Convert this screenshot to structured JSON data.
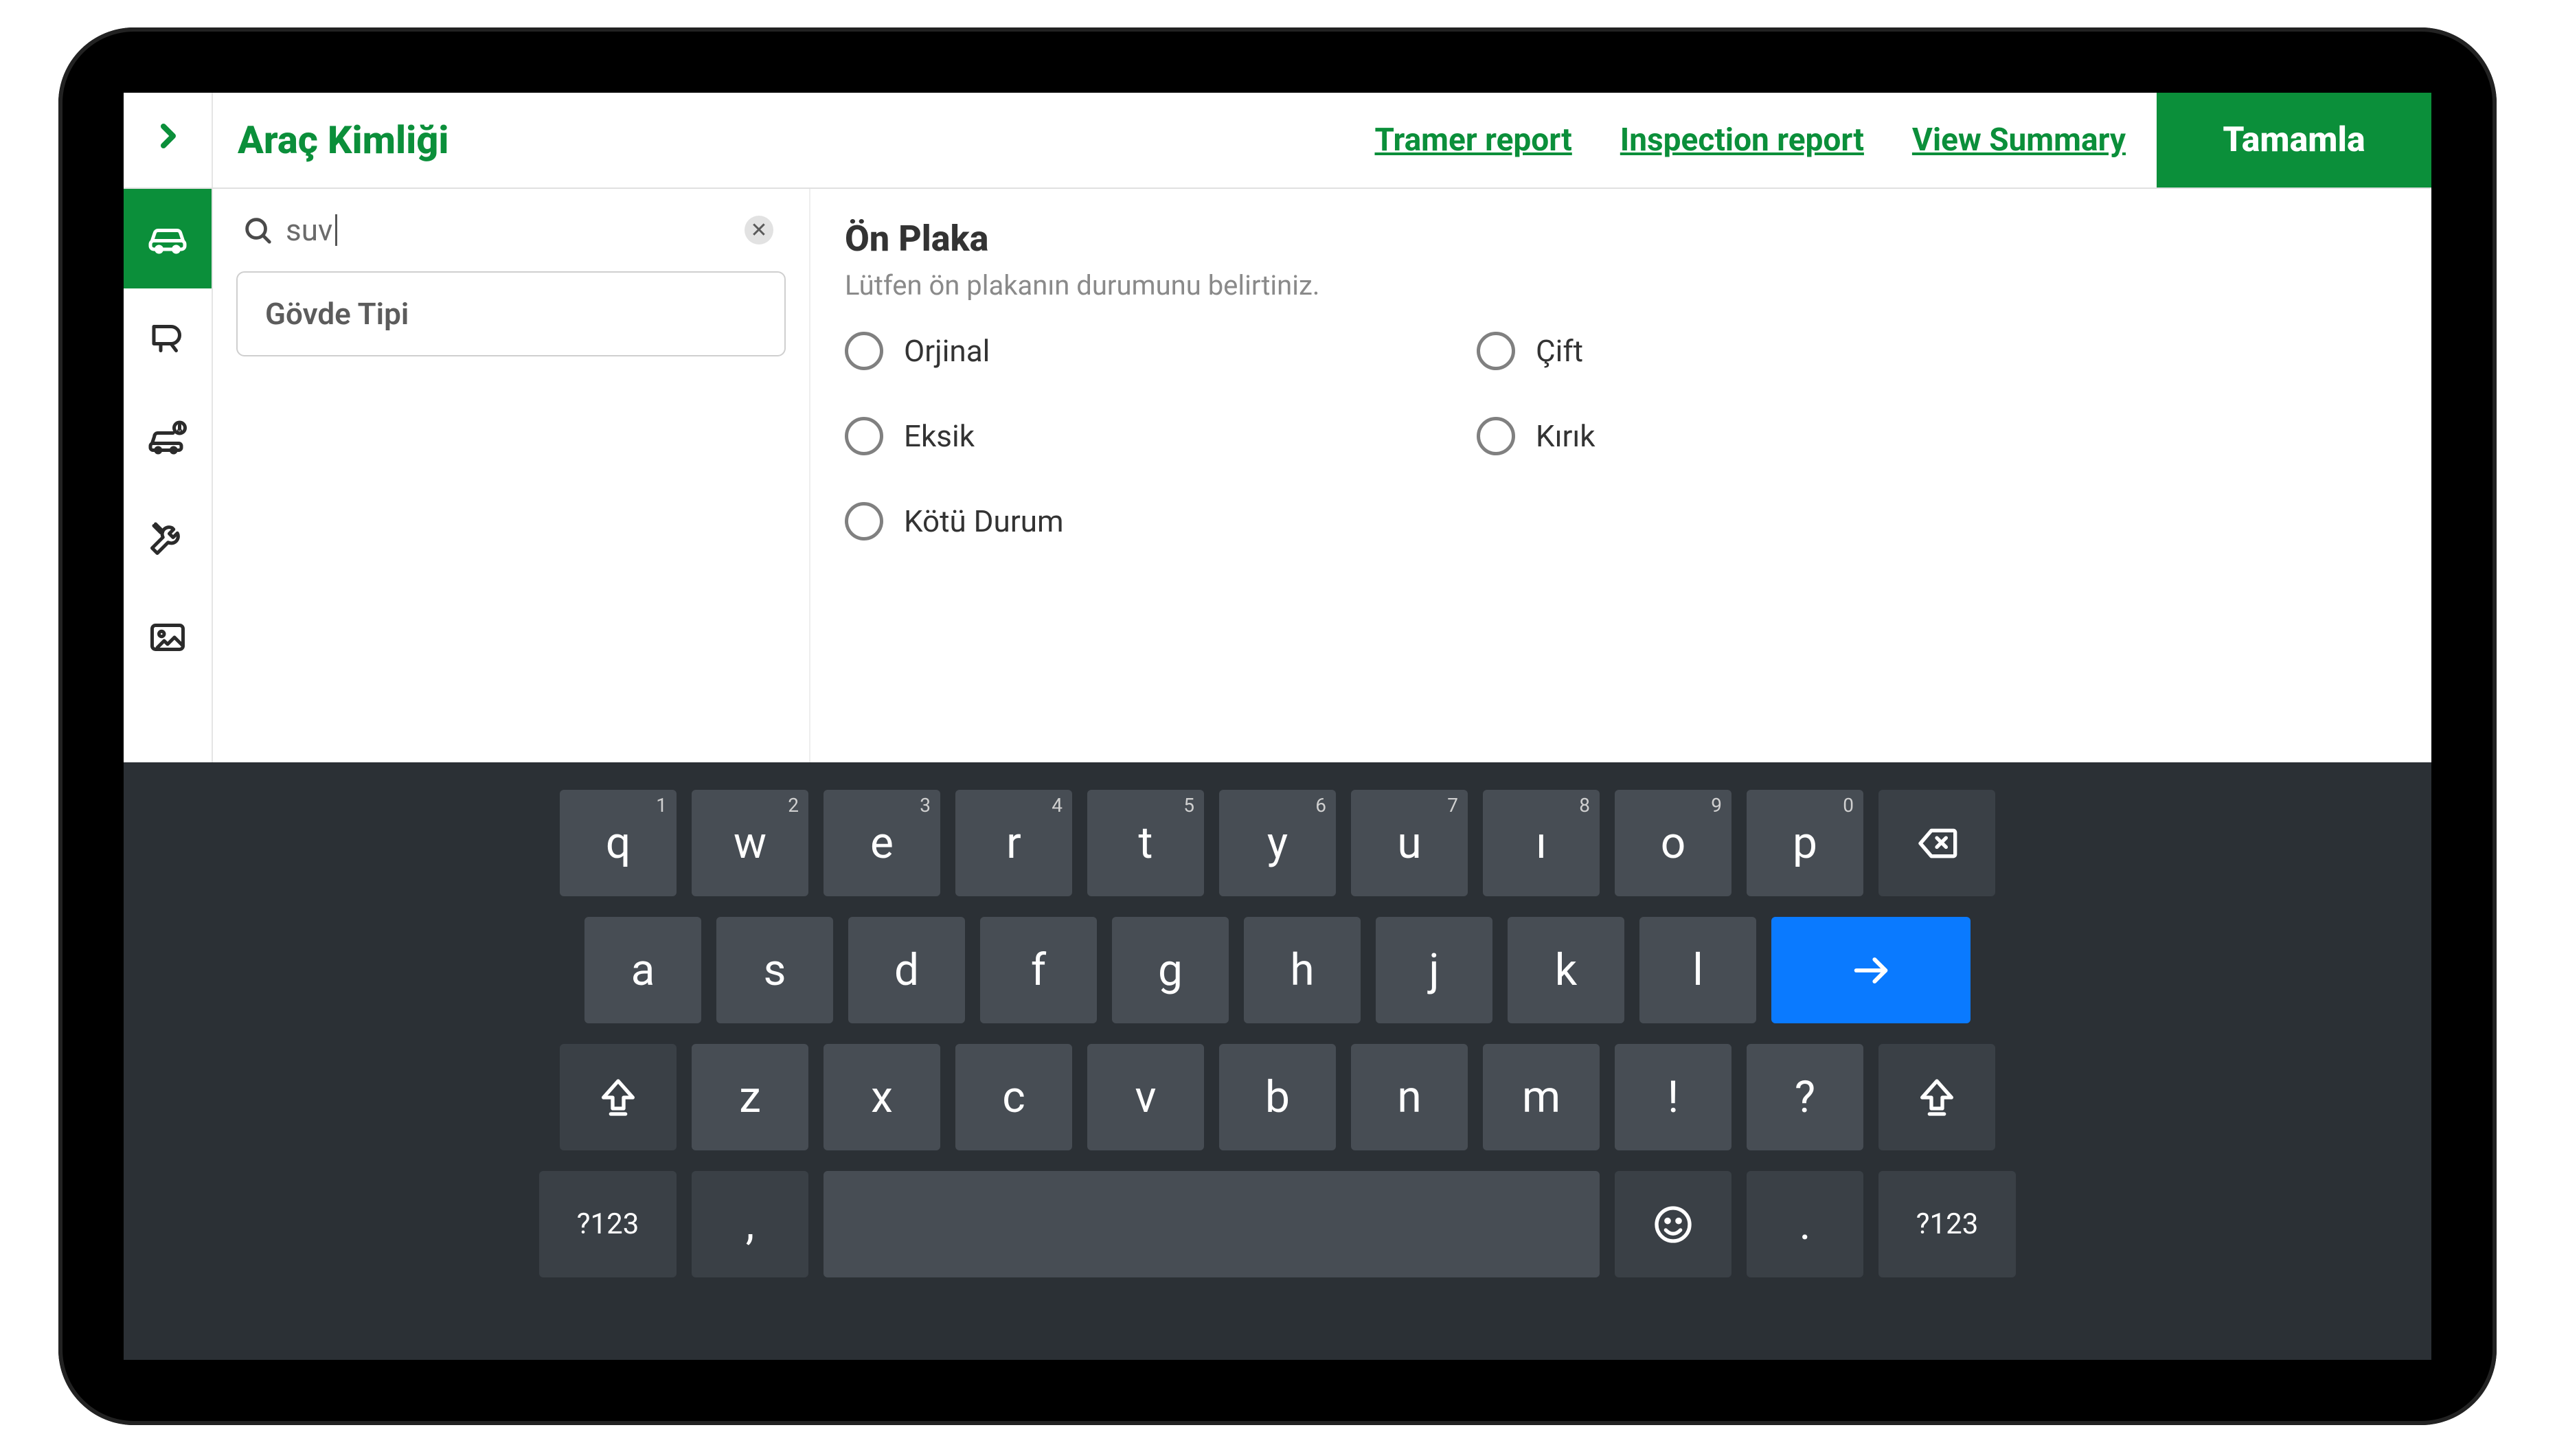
{
  "header": {
    "title": "Araç Kimliği",
    "links": {
      "tramer": "Tramer report",
      "inspection": "Inspection report",
      "summary": "View Summary"
    },
    "complete": "Tamamla"
  },
  "rail": {
    "items": [
      {
        "id": "car",
        "active": true
      },
      {
        "id": "damage",
        "active": false
      },
      {
        "id": "alert-car",
        "active": false
      },
      {
        "id": "tools",
        "active": false
      },
      {
        "id": "image",
        "active": false
      }
    ]
  },
  "sidebar": {
    "search_value": "suv",
    "suggestion": "Gövde Tipi"
  },
  "form": {
    "heading": "Ön Plaka",
    "subtitle": "Lütfen ön plakanın durumunu belirtiniz.",
    "options": [
      "Orjinal",
      "Çift",
      "Eksik",
      "Kırık",
      "Kötü Durum"
    ]
  },
  "keyboard": {
    "row1": [
      {
        "k": "q",
        "s": "1"
      },
      {
        "k": "w",
        "s": "2"
      },
      {
        "k": "e",
        "s": "3"
      },
      {
        "k": "r",
        "s": "4"
      },
      {
        "k": "t",
        "s": "5"
      },
      {
        "k": "y",
        "s": "6"
      },
      {
        "k": "u",
        "s": "7"
      },
      {
        "k": "ı",
        "s": "8"
      },
      {
        "k": "o",
        "s": "9"
      },
      {
        "k": "p",
        "s": "0"
      }
    ],
    "row2": [
      "a",
      "s",
      "d",
      "f",
      "g",
      "h",
      "j",
      "k",
      "l"
    ],
    "row3": [
      "z",
      "x",
      "c",
      "v",
      "b",
      "n",
      "m",
      "!",
      "?"
    ],
    "numswitch": "?123",
    "comma": ",",
    "period": "."
  }
}
